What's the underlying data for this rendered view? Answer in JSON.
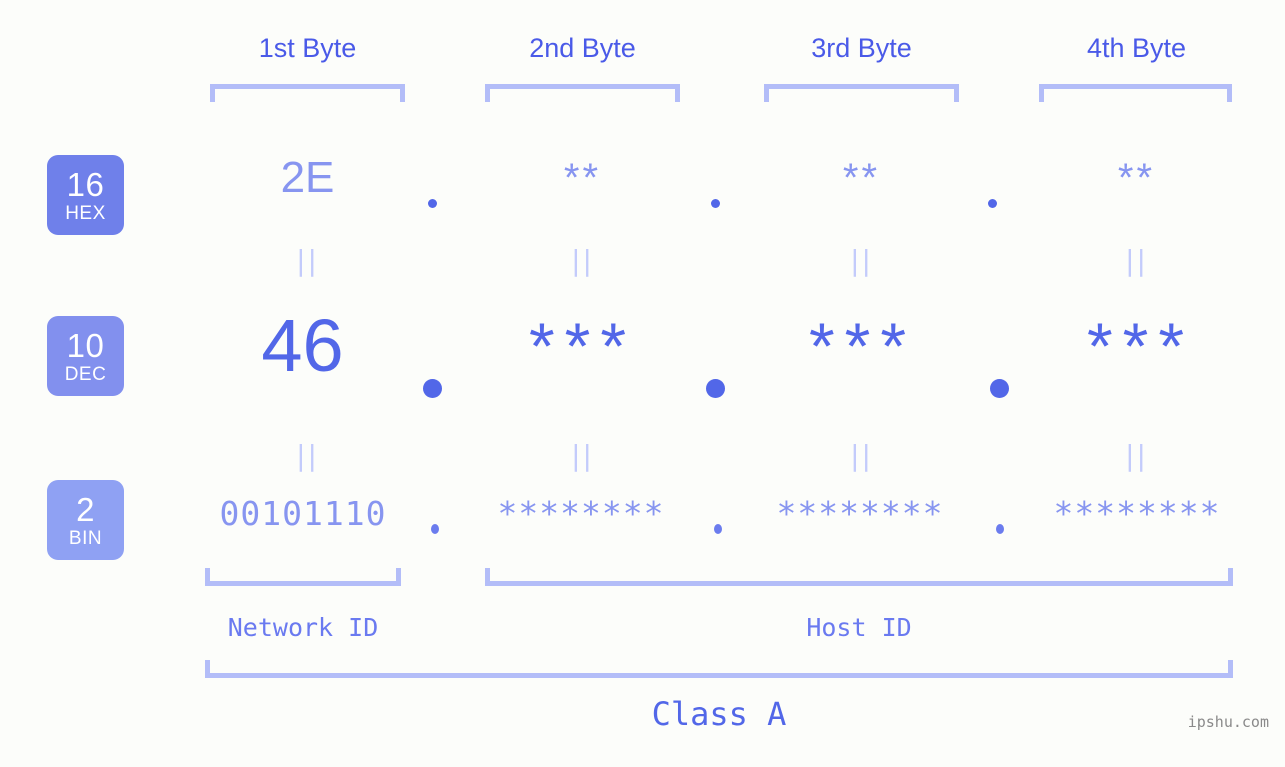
{
  "canvas": {
    "background": "#fcfdfa",
    "accent_strong": "#5267e8",
    "accent_mid": "#8795f0",
    "accent_light": "#b3bdf8",
    "watermark_color": "#8a8a8a"
  },
  "byte_headers": [
    {
      "label": "1st Byte"
    },
    {
      "label": "2nd Byte"
    },
    {
      "label": "3rd Byte"
    },
    {
      "label": "4th Byte"
    }
  ],
  "bases": [
    {
      "number": "16",
      "abbr": "HEX",
      "color": "#6f80ea"
    },
    {
      "number": "10",
      "abbr": "DEC",
      "color": "#8290ee"
    },
    {
      "number": "2",
      "abbr": "BIN",
      "color": "#8fa1f3"
    }
  ],
  "rows": {
    "hex": {
      "values": [
        "2E",
        "**",
        "**",
        "**"
      ],
      "separators": [
        ".",
        ".",
        "."
      ]
    },
    "dec": {
      "values": [
        "46",
        "***",
        "***",
        "***"
      ],
      "separators": [
        ".",
        ".",
        "."
      ]
    },
    "bin": {
      "values": [
        "00101110",
        "********",
        "********",
        "********"
      ],
      "separators": [
        ".",
        ".",
        "."
      ]
    }
  },
  "equality_marks": {
    "symbol": "||",
    "hex_to_dec": [
      "||",
      "||",
      "||",
      "||"
    ],
    "dec_to_bin": [
      "||",
      "||",
      "||",
      "||"
    ]
  },
  "id_sections": [
    {
      "label": "Network ID"
    },
    {
      "label": "Host ID"
    }
  ],
  "class_label": "Class A",
  "watermark": "ipshu.com"
}
